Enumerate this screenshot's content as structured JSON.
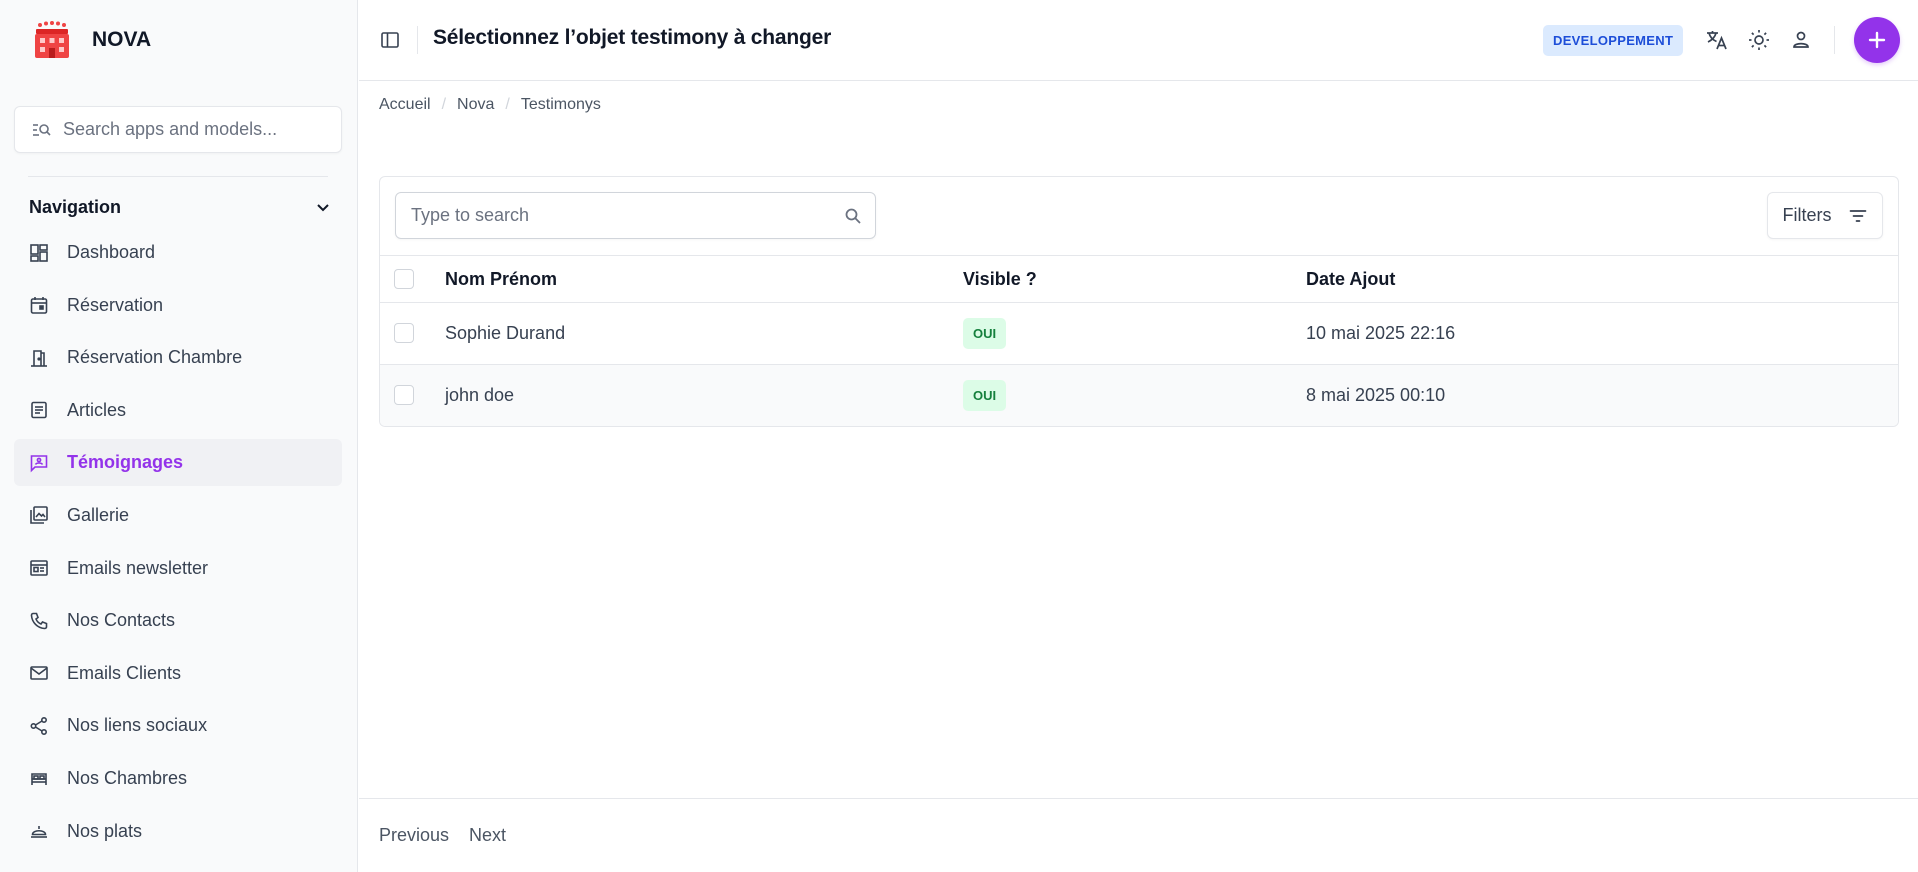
{
  "app": {
    "name": "NOVA"
  },
  "sidebar": {
    "search_placeholder": "Search apps and models...",
    "section_title": "Navigation",
    "items": [
      {
        "label": "Dashboard",
        "icon": "dashboard-icon"
      },
      {
        "label": "Réservation",
        "icon": "calendar-icon"
      },
      {
        "label": "Réservation Chambre",
        "icon": "door-icon"
      },
      {
        "label": "Articles",
        "icon": "article-icon"
      },
      {
        "label": "Témoignages",
        "icon": "testimony-icon",
        "active": true
      },
      {
        "label": "Gallerie",
        "icon": "gallery-icon"
      },
      {
        "label": "Emails newsletter",
        "icon": "newsletter-icon"
      },
      {
        "label": "Nos Contacts",
        "icon": "phone-icon"
      },
      {
        "label": "Emails Clients",
        "icon": "mail-icon"
      },
      {
        "label": "Nos liens sociaux",
        "icon": "share-icon"
      },
      {
        "label": "Nos Chambres",
        "icon": "bed-icon"
      },
      {
        "label": "Nos plats",
        "icon": "dish-icon"
      }
    ]
  },
  "header": {
    "title": "Sélectionnez l’objet testimony à changer",
    "env_badge": "DEVELOPPEMENT"
  },
  "breadcrumb": [
    "Accueil",
    "Nova",
    "Testimonys"
  ],
  "table": {
    "search_placeholder": "Type to search",
    "filters_label": "Filters",
    "columns": [
      "Nom Prénom",
      "Visible ?",
      "Date Ajout"
    ],
    "rows": [
      {
        "name": "Sophie Durand",
        "visible": "OUI",
        "date": "10 mai 2025 22:16"
      },
      {
        "name": "john doe",
        "visible": "OUI",
        "date": "8 mai 2025 00:10"
      }
    ]
  },
  "pagination": {
    "previous": "Previous",
    "next": "Next"
  },
  "colors": {
    "accent": "#9333ea",
    "env_badge_bg": "#dbeafe",
    "success_bg": "#dcfce7",
    "success_text": "#15803d"
  }
}
